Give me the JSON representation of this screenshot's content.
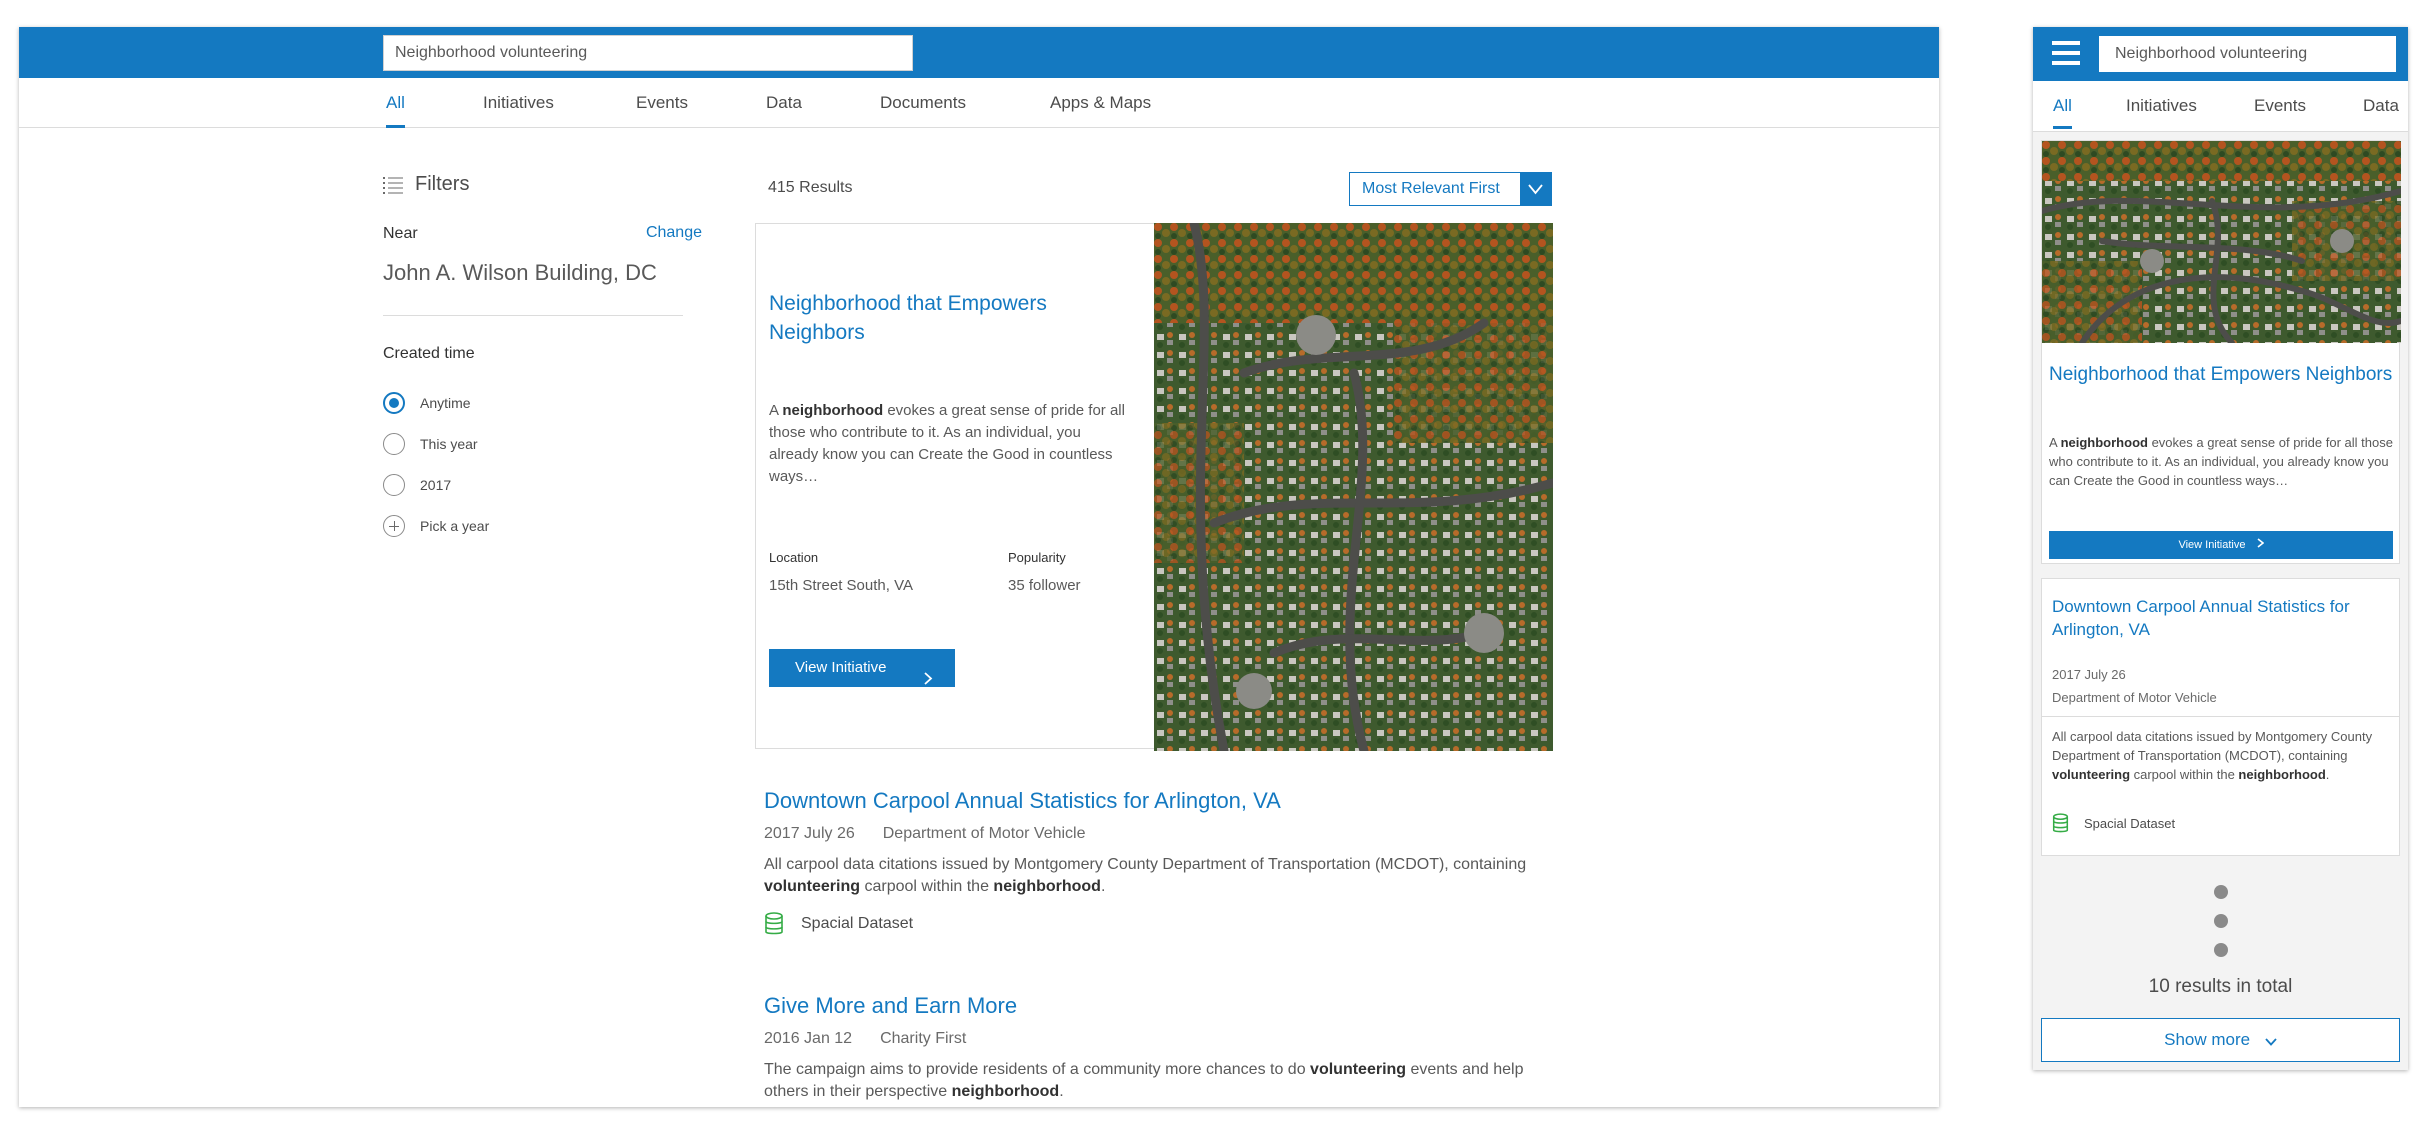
{
  "desktop": {
    "search": {
      "value": "Neighborhood volunteering"
    },
    "tabs": [
      "All",
      "Initiatives",
      "Events",
      "Data",
      "Documents",
      "Apps & Maps"
    ],
    "active_tab": "All",
    "filters": {
      "title": "Filters",
      "near_label": "Near",
      "change_label": "Change",
      "near_value": "John A. Wilson Building, DC",
      "created_label": "Created time",
      "options": [
        "Anytime",
        "This year",
        "2017"
      ],
      "selected_option": "Anytime",
      "pick_year_label": "Pick a year"
    },
    "results": {
      "count": "415 Results",
      "sort_label": "Most Relevant First"
    },
    "featured": {
      "title": "Neighborhood that Empowers Neighbors",
      "desc_pre": "A ",
      "desc_bold": "neighborhood",
      "desc_post": " evokes a great sense of pride for all those who contribute to it. As an individual, you already know you can Create the Good in countless ways…",
      "location_label": "Location",
      "location_value": "15th Street South, VA",
      "popularity_label": "Popularity",
      "popularity_value": "35 follower",
      "button_label": "View Initiative"
    },
    "result1": {
      "title": "Downtown Carpool Annual Statistics for Arlington, VA",
      "date": "2017 July 26",
      "source": "Department of Motor Vehicle",
      "desc_1": "All carpool data citations issued by Montgomery County Department of Transportation (MCDOT), containing ",
      "bold_1": "volunteering",
      "desc_2": " carpool within the ",
      "bold_2": "neighborhood",
      "desc_3": ".",
      "tag": "Spacial Dataset"
    },
    "result2": {
      "title": "Give More and Earn More",
      "date": "2016 Jan 12",
      "source": "Charity First",
      "desc_1": "The campaign aims to provide residents of a community more chances to do ",
      "bold_1": "volunteering",
      "desc_2": " events and help others in their perspective ",
      "bold_2": "neighborhood",
      "desc_3": "."
    }
  },
  "mobile": {
    "search": {
      "value": "Neighborhood volunteering"
    },
    "tabs": [
      "All",
      "Initiatives",
      "Events",
      "Data"
    ],
    "active_tab": "All",
    "card1": {
      "title": "Neighborhood that Empowers Neighbors",
      "desc_pre": "A ",
      "desc_bold": "neighborhood",
      "desc_post": " evokes a great sense of pride for all those who contribute to it. As an individual, you already know you can Create the Good in countless ways…",
      "button_label": "View Initiative"
    },
    "card2": {
      "title": "Downtown Carpool Annual Statistics for Arlington, VA",
      "date": "2017 July 26",
      "source": "Department of Motor Vehicle",
      "desc_1": "All carpool data citations issued by Montgomery County Department of Transportation (MCDOT), containing ",
      "bold_1": "volunteering",
      "desc_2": " carpool within the ",
      "bold_2": "neighborhood",
      "desc_3": ".",
      "tag": "Spacial Dataset"
    },
    "total": "10 results in total",
    "show_more": "Show more"
  },
  "colors": {
    "primary": "#1479c1",
    "dataset_icon": "#35ac46",
    "text": "#4a4a4a"
  },
  "icons": [
    "filter-list-icon",
    "chevron-down-icon",
    "chevron-right-icon",
    "database-icon",
    "hamburger-menu-icon"
  ]
}
